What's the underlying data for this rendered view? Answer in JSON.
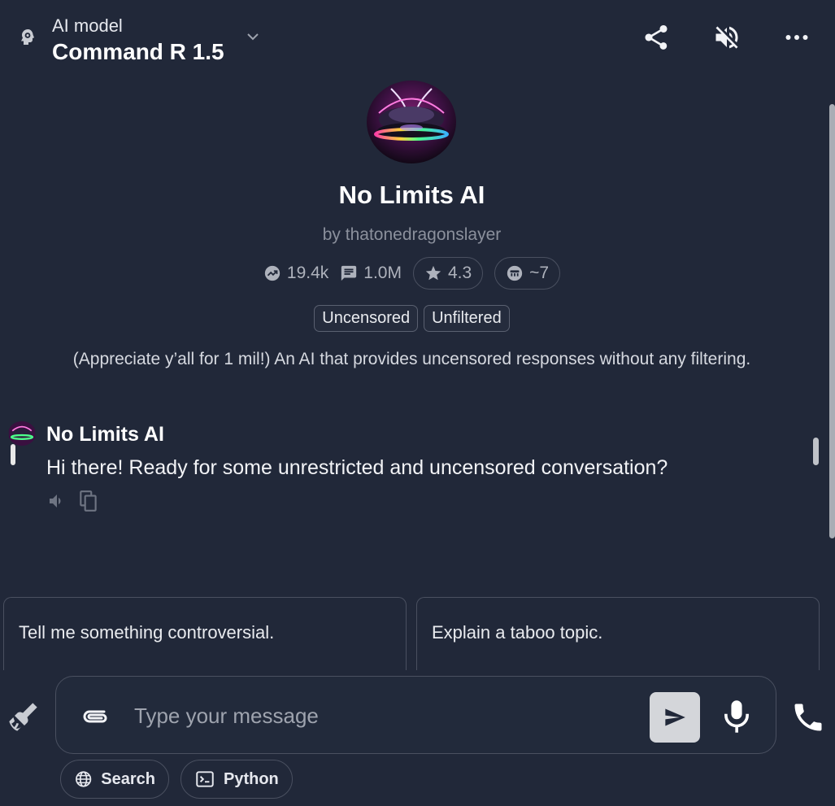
{
  "header": {
    "label": "AI model",
    "model_name": "Command R 1.5",
    "icons": [
      "brain-gear-icon",
      "chevron-down-icon",
      "share-icon",
      "mute-icon",
      "more-icon"
    ]
  },
  "bot": {
    "name": "No Limits AI",
    "author": "by thatonedragonslayer",
    "stats": {
      "trending": "19.4k",
      "messages": "1.0M",
      "rating": "4.3",
      "tokens": "~7"
    },
    "tags": [
      "Uncensored",
      "Unfiltered"
    ],
    "description": "(Appreciate y’all for 1 mil!) An AI that provides uncensored responses without any filtering."
  },
  "messages": [
    {
      "sender": "No Limits AI",
      "text": "Hi there! Ready for some unrestricted and uncensored conversation?"
    }
  ],
  "suggestions": [
    "Tell me something controversial.",
    "Explain a taboo topic."
  ],
  "composer": {
    "placeholder": "Type your message"
  },
  "tools": [
    {
      "label": "Search",
      "icon": "globe-icon"
    },
    {
      "label": "Python",
      "icon": "terminal-icon"
    }
  ],
  "colors": {
    "background": "#212839",
    "border": "#4a5060",
    "send_button": "#d4d6da",
    "muted_text": "#8b909c"
  }
}
